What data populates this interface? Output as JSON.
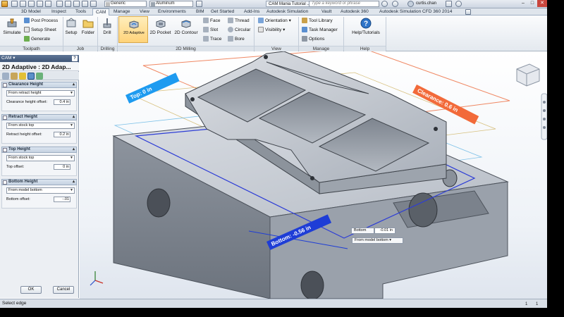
{
  "window": {
    "title": "CAM Mania Tutorial ...",
    "appearance_dropdown": "Generic",
    "material_dropdown": "Aluminum",
    "search_placeholder": "Type a keyword or phrase",
    "user": "curtis.chan",
    "min": "–",
    "max": "□",
    "close": "✕"
  },
  "tabs": [
    {
      "label": "3D Model"
    },
    {
      "label": "Inspect"
    },
    {
      "label": "Tools"
    },
    {
      "label": "CAM",
      "active": true
    },
    {
      "label": "Manage"
    },
    {
      "label": "View"
    },
    {
      "label": "Environments"
    },
    {
      "label": "BIM"
    },
    {
      "label": "Get Started"
    },
    {
      "label": "Add-Ins"
    },
    {
      "label": "Autodesk Simulation"
    },
    {
      "label": "Vault"
    },
    {
      "label": "Autodesk 360"
    },
    {
      "label": "Autodesk Simulation CFD 360 2014"
    }
  ],
  "ribbon": {
    "toolpath": {
      "label": "Toolpath",
      "simulate": "Simulate",
      "post_process": "Post Process",
      "setup_sheet": "Setup Sheet",
      "generate": "Generate"
    },
    "job": {
      "label": "Job",
      "setup": "Setup",
      "folder": "Folder"
    },
    "drilling": {
      "label": "Drilling",
      "drill": "Drill"
    },
    "milling2d": {
      "label": "2D Milling",
      "adaptive": "2D Adaptive",
      "pocket": "2D Pocket",
      "contour": "2D Contour",
      "face": "Face",
      "slot": "Slot",
      "trace": "Trace",
      "thread": "Thread",
      "circular": "Circular",
      "bore": "Bore"
    },
    "view": {
      "label": "View",
      "orientation": "Orientation",
      "visibility": "Visibility"
    },
    "manage": {
      "label": "Manage",
      "tool_library": "Tool Library",
      "task_manager": "Task Manager",
      "options": "Options"
    },
    "help": {
      "label": "Help",
      "help_tutorials": "Help/Tutorials"
    }
  },
  "panel": {
    "header": "CAM",
    "help": "?",
    "title": "2D Adaptive : 2D Adap...",
    "sections": [
      {
        "title": "Clearance Height",
        "select": "From retract height",
        "field_label": "Clearance height offset:",
        "field_value": "0.4 in"
      },
      {
        "title": "Retract Height",
        "select": "From stock top",
        "field_label": "Retract height offset:",
        "field_value": "0.2 in"
      },
      {
        "title": "Top Height",
        "select": "From stock top",
        "field_label": "Top offset:",
        "field_value": "0 in"
      },
      {
        "title": "Bottom Height",
        "select": "From model bottom",
        "field_label": "Bottom offset:",
        "field_value": "-.01"
      }
    ],
    "ok": "OK",
    "cancel": "Cancel"
  },
  "viewport": {
    "clearance_tag": "Clearance: 0.6 in",
    "top_tag": "Top: 0 in",
    "bottom_tag": "Bottom: -0.56 in",
    "chip_label": "Bottom",
    "chip_value": "-0.01 in",
    "chip_ref": "From model bottom"
  },
  "status": {
    "text": "Select edge",
    "count_a": "1",
    "count_b": "1"
  },
  "colors": {
    "accent_orange": "#f26a3a",
    "accent_blue": "#1e66ff",
    "ribbon_selected": "#ffd37a",
    "panel_header": "#3f5677"
  }
}
